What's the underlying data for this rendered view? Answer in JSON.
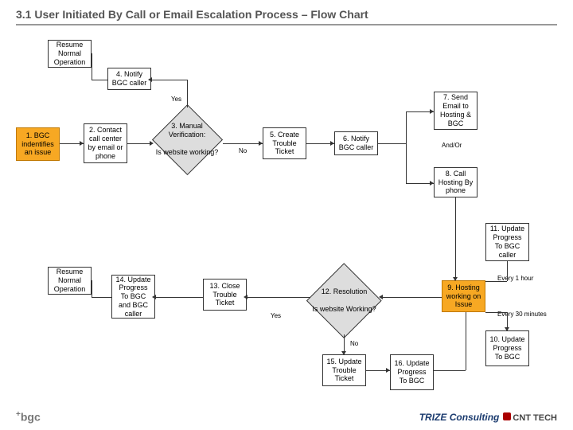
{
  "title": "3.1 User Initiated By Call or Email Escalation Process – Flow Chart",
  "nodes": {
    "resume1": "Resume\nNormal\nOperation",
    "n4": "4. Notify BGC caller",
    "yes1": "Yes",
    "n1": "1. BGC indentifies an issue",
    "n2": "2. Contact call center by email or phone",
    "n3": "3. Manual Verification:",
    "n3q": "Is website working?",
    "no1": "No",
    "n5": "5. Create Trouble Ticket",
    "n6": "6. Notify BGC caller",
    "n7": "7. Send Email to Hosting & BGC",
    "andor": "And/Or",
    "n8": "8. Call Hosting By phone",
    "n11": "11. Update Progress To BGC caller",
    "resume2": "Resume\nNormal\nOperation",
    "n14": "14. Update Progress To BGC and BGC caller",
    "n13": "13. Close Trouble Ticket",
    "n12": "12. Resolution",
    "n12q": "Is website Working?",
    "n9": "9. Hosting working on Issue",
    "every1h": "Every 1 hour",
    "every30": "Every 30 minutes",
    "yes2": "Yes",
    "no2": "No",
    "n15": "15. Update Trouble Ticket",
    "n16": "16. Update Progress To BGC",
    "n10": "10. Update Progress To BGC"
  },
  "footer": {
    "bgc": "bgc",
    "trize": "TRIZE Consulting",
    "cnt": "CNT TECH"
  }
}
